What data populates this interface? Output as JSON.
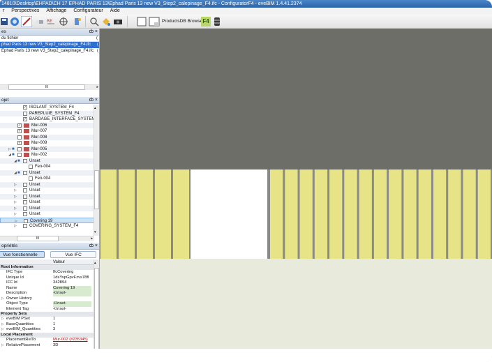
{
  "window": {
    "title": "14810\\Desktop\\EHPAD\\CH 17 EPHAD PARIS 13\\Ephad Paris 13 new V3_Step2_calepinage_F4.ifc - ConfiguratorF4 - eveBIM 1.4.41.2374"
  },
  "menu": [
    "Perspectives",
    "Affichage",
    "Configurateur",
    "Aide"
  ],
  "toolbar": {
    "products_label": "ProductsDB Browser",
    "f4_label": "F4"
  },
  "files_panel": {
    "title": "es",
    "close": "ȸ ×",
    "column": "du fichier",
    "column_end": "(",
    "rows": [
      {
        "text": "phad Paris 13 new V3_Step2_calepinage_F4.ifc",
        "end": "(",
        "selected": true
      },
      {
        "text": "Ephad Paris 13 new V3_Step2_calepinage_F4.ifc",
        "end": "(",
        "selected": false
      }
    ],
    "hscroll": "III"
  },
  "project_panel": {
    "title": "ojet",
    "close": "ȸ ×",
    "rows": [
      {
        "indent": 2,
        "check": "✓",
        "color": "",
        "label": "ISOLANT_SYSTEM_F4"
      },
      {
        "indent": 2,
        "check": "",
        "color": "",
        "label": "PAREPLUIE_SYSTEM_F4"
      },
      {
        "indent": 2,
        "check": "✓",
        "color": "",
        "label": "BARDAGE_INTERFACE_SYSTEM_F"
      },
      {
        "indent": 1,
        "check": "✓",
        "color": "#c0504d",
        "label": "Mur-006"
      },
      {
        "indent": 1,
        "check": "✓",
        "color": "#c0504d",
        "label": "Mur-007"
      },
      {
        "indent": 1,
        "check": "",
        "color": "#c0504d",
        "label": "Mur-008"
      },
      {
        "indent": 1,
        "check": "✓",
        "color": "#c0504d",
        "label": "Mur-009"
      },
      {
        "indent": 1,
        "check": "",
        "color": "#c0504d",
        "label": "Mur-005",
        "exp": "▷",
        "ptri": "■"
      },
      {
        "indent": 1,
        "check": "",
        "color": "#c0504d",
        "label": "Mur-002",
        "exp": "◢",
        "ptri": "■"
      },
      {
        "indent": 2,
        "check": "",
        "color": "",
        "label": "Unset",
        "exp": "◢",
        "ptri": "■"
      },
      {
        "indent": 3,
        "check": "",
        "color": "",
        "label": "Fen-004"
      },
      {
        "indent": 2,
        "check": "",
        "color": "",
        "label": "Unset",
        "exp": "◢",
        "ptri": "■"
      },
      {
        "indent": 3,
        "check": "",
        "color": "",
        "label": "Fen-004"
      },
      {
        "indent": 2,
        "check": "",
        "color": "",
        "label": "Unset",
        "exp": "▷"
      },
      {
        "indent": 2,
        "check": "",
        "color": "",
        "label": "Unset",
        "exp": "▷"
      },
      {
        "indent": 2,
        "check": "",
        "color": "",
        "label": "Unset",
        "exp": "▷"
      },
      {
        "indent": 2,
        "check": "",
        "color": "",
        "label": "Unset",
        "exp": "▷"
      },
      {
        "indent": 2,
        "check": "",
        "color": "",
        "label": "Unset",
        "exp": "▷"
      },
      {
        "indent": 2,
        "check": "",
        "color": "",
        "label": "Unset",
        "exp": "▷"
      },
      {
        "indent": 2,
        "check": "",
        "color": "",
        "label": "Covering 19",
        "exp": "▷",
        "highlight": true
      },
      {
        "indent": 2,
        "check": "",
        "color": "",
        "label": "COVERING_SYSTEM_F4",
        "exp": "▷"
      }
    ],
    "hscroll": "III"
  },
  "properties_panel": {
    "title": "opriétés",
    "close": "ȸ ×",
    "tabs": [
      "Vue fonctionnelle",
      "Vue IFC"
    ],
    "value_header": "Valeur",
    "rows": [
      {
        "section": true,
        "key": "Root Information"
      },
      {
        "key": "IFC Type",
        "value": "IfcCovering"
      },
      {
        "key": "Unique Id",
        "value": "1dsYvpGpvFzvs78fl"
      },
      {
        "key": "IFC Id",
        "value": "342894"
      },
      {
        "key": "Name",
        "value": "Covering 19",
        "green": true
      },
      {
        "key": "Description",
        "value": "-Unset-",
        "green": true,
        "italic": true
      },
      {
        "key": "Owner History",
        "value": "",
        "exp": "▷"
      },
      {
        "key": "Object Type",
        "value": "-Unset-",
        "green": true,
        "italic": true
      },
      {
        "key": "Element Tag",
        "value": "-Unset-",
        "italic": true
      },
      {
        "section": true,
        "key": "Property Sets"
      },
      {
        "key": "eveBIM PSet",
        "value": "1",
        "exp": "▷"
      },
      {
        "key": "BaseQuantities",
        "value": "1",
        "exp": "▷"
      },
      {
        "key": "eveBIM_Quantities",
        "value": "3",
        "exp": "▷"
      },
      {
        "section": true,
        "key": "Local Placement"
      },
      {
        "key": "PlacementRelTo",
        "value": "Mur-002 (#235345)",
        "link": true
      },
      {
        "key": "RelativePlacement",
        "value": "3D",
        "exp": "▷"
      }
    ]
  },
  "viewport": {
    "colors": {
      "sky": "#6e6e69",
      "panel": "#e6e487",
      "gap": "#8a8a86",
      "floor": "#e8eadc",
      "opening": "#ffffff"
    },
    "left_boards": 5,
    "right_boards": 15
  }
}
